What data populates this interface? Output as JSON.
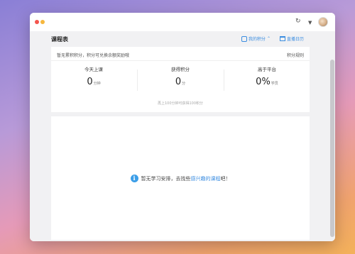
{
  "titlebar": {
    "refresh_icon": "refresh-icon",
    "chevron_icon": "chevron-down-icon"
  },
  "header": {
    "title": "课程表",
    "points_link": "我的积分",
    "calendar_link": "直播日历"
  },
  "points_card": {
    "notice": "暂无累积积分，积分可兑换余额奖励哦",
    "rules_link": "积分规则",
    "stats": [
      {
        "label": "今天上课",
        "value": "0",
        "unit": "分钟"
      },
      {
        "label": "获得积分",
        "value": "0",
        "unit": "分"
      },
      {
        "label": "高于平台",
        "value": "0%",
        "unit": "学员"
      }
    ],
    "hint": "再上100分钟可获得100积分"
  },
  "empty_state": {
    "prefix": "暂无学习安排，去找些",
    "link": "感兴趣的课程",
    "suffix": "吧！"
  },
  "colors": {
    "accent": "#3b8de0",
    "info": "#3b9ee8"
  }
}
